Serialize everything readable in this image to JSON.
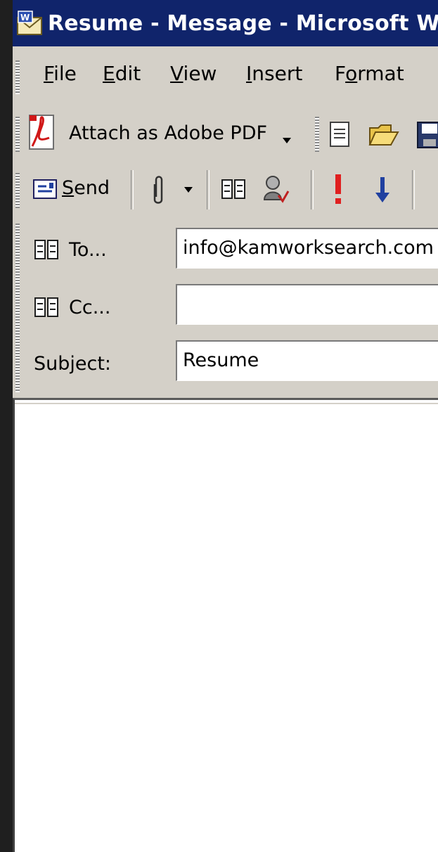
{
  "window": {
    "title": "Resume - Message - Microsoft Wor"
  },
  "menu": [
    {
      "label": "File",
      "mnemonic": "F"
    },
    {
      "label": "Edit",
      "mnemonic": "E"
    },
    {
      "label": "View",
      "mnemonic": "V"
    },
    {
      "label": "Insert",
      "mnemonic": "I"
    },
    {
      "label": "Format",
      "mnemonic": "o"
    }
  ],
  "toolbar1": {
    "attach_pdf_label": "Attach as Adobe PDF"
  },
  "toolbar2": {
    "send_label": "Send"
  },
  "headers": {
    "to_label": "To...",
    "to_value": "info@kamworksearch.com",
    "cc_label": "Cc...",
    "cc_value": "",
    "subject_label": "Subject:",
    "subject_value": "Resume"
  },
  "colors": {
    "titlebar": "#10246b",
    "chrome": "#d4d0c8",
    "importance_high": "#e02020",
    "importance_low": "#2040a0"
  },
  "icons": [
    "word-mail-icon",
    "pdf-icon",
    "new-doc-icon",
    "open-folder-icon",
    "save-icon",
    "send-icon",
    "paperclip-icon",
    "dropdown-arrow-icon",
    "address-book-icon",
    "check-names-icon",
    "high-importance-icon",
    "low-importance-icon"
  ]
}
